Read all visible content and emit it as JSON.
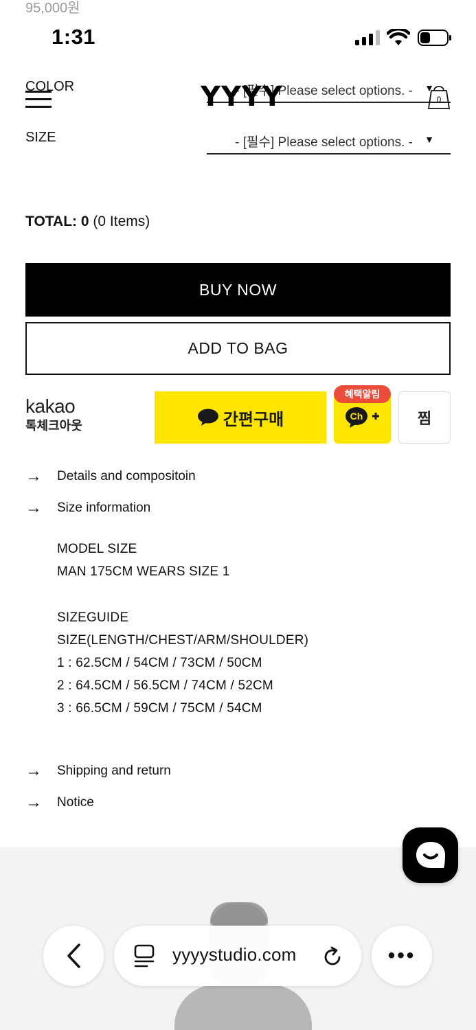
{
  "price_peek": "95,000원",
  "status": {
    "time": "1:31"
  },
  "header": {
    "logo": "YYYY",
    "bag_count": "0"
  },
  "options": {
    "color_label": "COLOR",
    "size_label": "SIZE",
    "color_value": "- [필수] Please select options. -",
    "size_value": "- [필수] Please select options. -"
  },
  "total": {
    "label": "TOTAL:",
    "amount": "0",
    "items": "(0 Items)"
  },
  "buttons": {
    "buy_now": "BUY NOW",
    "add_to_bag": "ADD TO BAG",
    "kakao_pay": "간편구매",
    "benefit_badge": "혜택알림",
    "channel": "Ch",
    "wish": "찜"
  },
  "kakao": {
    "brand": "kakao",
    "sub": "톡체크아웃"
  },
  "accordion": {
    "details": "Details and compositoin",
    "size_info": "Size information",
    "shipping": "Shipping and return",
    "notice": "Notice"
  },
  "size_info": {
    "model_title": "MODEL SIZE",
    "model_desc": "MAN 175CM WEARS SIZE 1",
    "guide_title": "SIZEGUIDE",
    "guide_header": "SIZE(LENGTH/CHEST/ARM/SHOULDER)",
    "rows": [
      "1 : 62.5CM / 54CM / 73CM / 50CM",
      "2 : 64.5CM / 56.5CM / 74CM / 52CM",
      "3 : 66.5CM / 59CM / 75CM / 54CM"
    ]
  },
  "browser": {
    "url": "yyyystudio.com",
    "more": "•••"
  },
  "colors": {
    "kakao_yellow": "#fee500",
    "badge_red": "#ec4d3a",
    "black": "#000000"
  }
}
